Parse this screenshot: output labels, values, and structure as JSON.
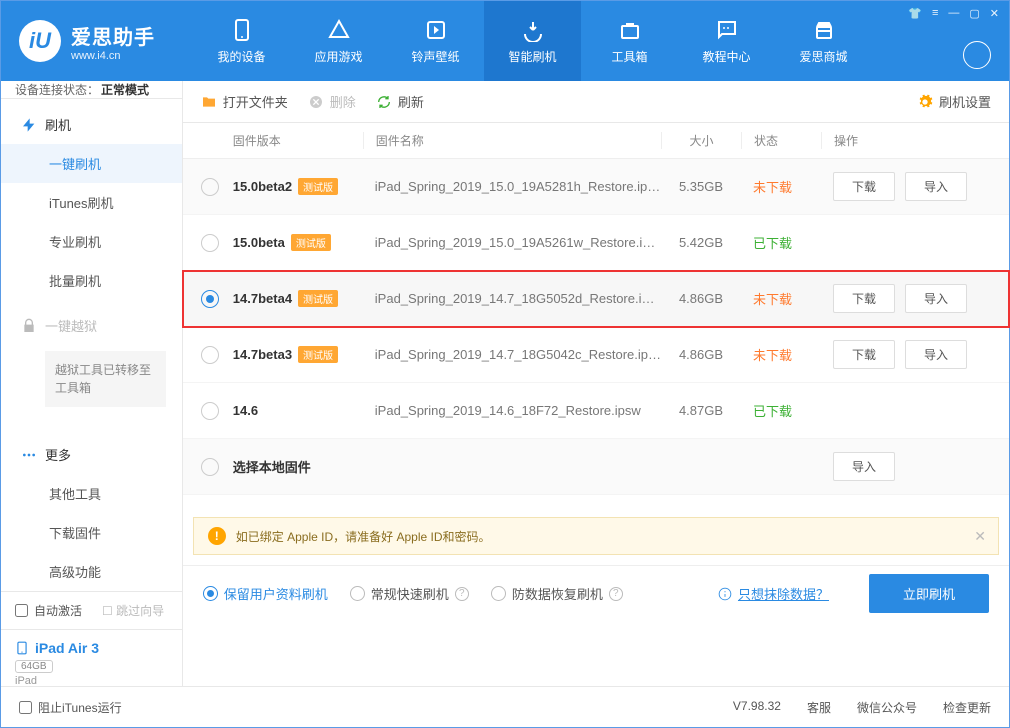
{
  "logo": {
    "title": "爱思助手",
    "url": "www.i4.cn"
  },
  "nav": [
    "我的设备",
    "应用游戏",
    "铃声壁纸",
    "智能刷机",
    "工具箱",
    "教程中心",
    "爱思商城"
  ],
  "nav_active": 3,
  "conn": {
    "label": "设备连接状态：",
    "value": "正常模式"
  },
  "side": {
    "flash": {
      "head": "刷机",
      "items": [
        "一键刷机",
        "iTunes刷机",
        "专业刷机",
        "批量刷机"
      ],
      "active": 0
    },
    "jailbreak": {
      "head": "一键越狱",
      "note": "越狱工具已转移至工具箱"
    },
    "more": {
      "head": "更多",
      "items": [
        "其他工具",
        "下载固件",
        "高级功能"
      ]
    }
  },
  "auto_activate": "自动激活",
  "skip_guide": "跳过向导",
  "device": {
    "name": "iPad Air 3",
    "capacity": "64GB",
    "model": "iPad"
  },
  "toolbar": {
    "open": "打开文件夹",
    "delete": "删除",
    "refresh": "刷新",
    "settings": "刷机设置"
  },
  "cols": {
    "ver": "固件版本",
    "name": "固件名称",
    "size": "大小",
    "status": "状态",
    "ops": "操作"
  },
  "btns": {
    "download": "下载",
    "import": "导入"
  },
  "status": {
    "no": "未下载",
    "yes": "已下载"
  },
  "tag": "测试版",
  "rows": [
    {
      "ver": "15.0beta2",
      "tag": true,
      "name": "iPad_Spring_2019_15.0_19A5281h_Restore.ip…",
      "size": "5.35GB",
      "status": "no",
      "dl": true,
      "imp": true,
      "sel": false,
      "alt": true
    },
    {
      "ver": "15.0beta",
      "tag": true,
      "name": "iPad_Spring_2019_15.0_19A5261w_Restore.i…",
      "size": "5.42GB",
      "status": "yes",
      "dl": false,
      "imp": false,
      "sel": false
    },
    {
      "ver": "14.7beta4",
      "tag": true,
      "name": "iPad_Spring_2019_14.7_18G5052d_Restore.i…",
      "size": "4.86GB",
      "status": "no",
      "dl": true,
      "imp": true,
      "sel": true
    },
    {
      "ver": "14.7beta3",
      "tag": true,
      "name": "iPad_Spring_2019_14.7_18G5042c_Restore.ip…",
      "size": "4.86GB",
      "status": "no",
      "dl": true,
      "imp": true,
      "sel": false
    },
    {
      "ver": "14.6",
      "tag": false,
      "name": "iPad_Spring_2019_14.6_18F72_Restore.ipsw",
      "size": "4.87GB",
      "status": "yes",
      "dl": false,
      "imp": false,
      "sel": false
    },
    {
      "ver": "选择本地固件",
      "local": true,
      "imp": true,
      "alt": true
    }
  ],
  "warn": "如已绑定 Apple ID，请准备好 Apple ID和密码。",
  "modes": [
    "保留用户资料刷机",
    "常规快速刷机",
    "防数据恢复刷机"
  ],
  "mode_active": 0,
  "erase_link": "只想抹除数据？",
  "flash_now": "立即刷机",
  "statusbar": {
    "block": "阻止iTunes运行",
    "ver": "V7.98.32",
    "cs": "客服",
    "wechat": "微信公众号",
    "update": "检查更新"
  }
}
